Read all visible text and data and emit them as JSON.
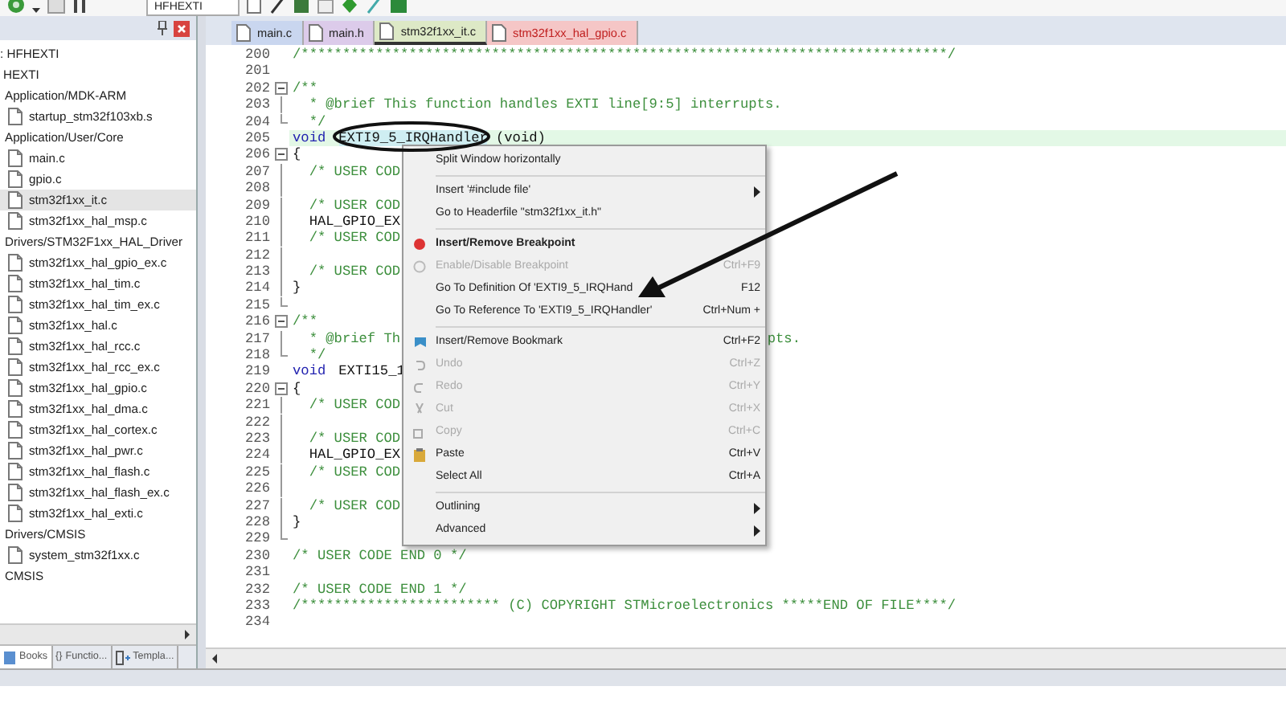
{
  "toolbar": {
    "target": "HFHEXTI"
  },
  "sidebar": {
    "tree": [
      {
        "label": ": HFHEXTI",
        "children": [
          {
            "label": "HEXTI",
            "children": [
              {
                "label": "Application/MDK-ARM",
                "children": [
                  {
                    "label": "startup_stm32f103xb.s",
                    "selected": false
                  }
                ]
              },
              {
                "label": "Application/User/Core",
                "children": [
                  {
                    "label": "main.c",
                    "selected": false
                  },
                  {
                    "label": "gpio.c",
                    "selected": false
                  },
                  {
                    "label": "stm32f1xx_it.c",
                    "selected": true
                  },
                  {
                    "label": "stm32f1xx_hal_msp.c",
                    "selected": false
                  }
                ]
              },
              {
                "label": "Drivers/STM32F1xx_HAL_Driver",
                "children": [
                  {
                    "label": "stm32f1xx_hal_gpio_ex.c",
                    "selected": false
                  },
                  {
                    "label": "stm32f1xx_hal_tim.c",
                    "selected": false
                  },
                  {
                    "label": "stm32f1xx_hal_tim_ex.c",
                    "selected": false
                  },
                  {
                    "label": "stm32f1xx_hal.c",
                    "selected": false
                  },
                  {
                    "label": "stm32f1xx_hal_rcc.c",
                    "selected": false
                  },
                  {
                    "label": "stm32f1xx_hal_rcc_ex.c",
                    "selected": false
                  },
                  {
                    "label": "stm32f1xx_hal_gpio.c",
                    "selected": false
                  },
                  {
                    "label": "stm32f1xx_hal_dma.c",
                    "selected": false
                  },
                  {
                    "label": "stm32f1xx_hal_cortex.c",
                    "selected": false
                  },
                  {
                    "label": "stm32f1xx_hal_pwr.c",
                    "selected": false
                  },
                  {
                    "label": "stm32f1xx_hal_flash.c",
                    "selected": false
                  },
                  {
                    "label": "stm32f1xx_hal_flash_ex.c",
                    "selected": false
                  },
                  {
                    "label": "stm32f1xx_hal_exti.c",
                    "selected": false
                  }
                ]
              },
              {
                "label": "Drivers/CMSIS",
                "children": [
                  {
                    "label": "system_stm32f1xx.c",
                    "selected": false
                  }
                ]
              },
              {
                "label": "CMSIS"
              }
            ]
          }
        ]
      }
    ],
    "bottom_tabs": [
      {
        "label": "Books",
        "selected": true
      },
      {
        "glyph": "{}",
        "label": "Functio...",
        "selected": false
      },
      {
        "label": "Templa...",
        "selected": false
      }
    ]
  },
  "editor": {
    "tabs": [
      {
        "label": "main.c",
        "color": "#c9d6ef",
        "selected": false
      },
      {
        "label": "main.h",
        "color": "#dccbea",
        "selected": false
      },
      {
        "label": "stm32f1xx_it.c",
        "color": "#dde9c6",
        "selected": true
      },
      {
        "label": "stm32f1xx_hal_gpio.c",
        "color": "#f5c6c6",
        "selected": false
      }
    ],
    "lines": [
      {
        "number": "200",
        "kind": "plain",
        "parts": [
          {
            "kind": "comment",
            "text": "/******************************************************************************/"
          }
        ]
      },
      {
        "number": "201",
        "kind": "plain"
      },
      {
        "number": "202",
        "kind": "foldstart",
        "parts": [
          {
            "kind": "comment",
            "text": "/**"
          }
        ]
      },
      {
        "number": "203",
        "kind": "foldbody",
        "parts": [
          {
            "kind": "comment",
            "text": "  * @brief This function handles EXTI line[9:5] interrupts."
          }
        ]
      },
      {
        "number": "204",
        "kind": "foldend",
        "parts": [
          {
            "kind": "comment",
            "text": "  */"
          }
        ]
      },
      {
        "number": "205",
        "kind": "plain",
        "current": true,
        "parts": [
          {
            "kind": "keyword",
            "text": "void"
          },
          {
            "kind": "selected",
            "text": "EXTI9_5_IRQHandler"
          },
          {
            "kind": "plain",
            "text": "(void)"
          }
        ]
      },
      {
        "number": "206",
        "kind": "foldstart",
        "parts": [
          {
            "kind": "plain",
            "text": "{"
          }
        ]
      },
      {
        "number": "207",
        "kind": "foldbody",
        "parts": [
          {
            "kind": "comment",
            "text": "  /* USER COD"
          }
        ]
      },
      {
        "number": "208",
        "kind": "foldbody"
      },
      {
        "number": "209",
        "kind": "foldbody",
        "parts": [
          {
            "kind": "comment",
            "text": "  /* USER COD"
          }
        ]
      },
      {
        "number": "210",
        "kind": "foldbody",
        "parts": [
          {
            "kind": "plain",
            "text": "  HAL_GPIO_EX"
          }
        ]
      },
      {
        "number": "211",
        "kind": "foldbody",
        "parts": [
          {
            "kind": "comment",
            "text": "  /* USER COD"
          }
        ]
      },
      {
        "number": "212",
        "kind": "foldbody"
      },
      {
        "number": "213",
        "kind": "foldbody",
        "parts": [
          {
            "kind": "comment",
            "text": "  /* USER COD"
          }
        ]
      },
      {
        "number": "214",
        "kind": "foldbody",
        "parts": [
          {
            "kind": "plain",
            "text": "}"
          }
        ]
      },
      {
        "number": "215",
        "kind": "foldend"
      },
      {
        "number": "216",
        "kind": "foldstart",
        "parts": [
          {
            "kind": "comment",
            "text": "/**"
          }
        ]
      },
      {
        "number": "217",
        "kind": "foldbody",
        "parts": [
          {
            "kind": "comment",
            "text": "  * @brief Th"
          }
        ],
        "tail": "pts."
      },
      {
        "number": "218",
        "kind": "foldend",
        "parts": [
          {
            "kind": "comment",
            "text": "  */"
          }
        ]
      },
      {
        "number": "219",
        "kind": "plain",
        "parts": [
          {
            "kind": "keyword",
            "text": "void"
          },
          {
            "kind": "plain",
            "text": "EXTI15_1"
          }
        ]
      },
      {
        "number": "220",
        "kind": "foldstart",
        "parts": [
          {
            "kind": "plain",
            "text": "{"
          }
        ]
      },
      {
        "number": "221",
        "kind": "foldbody",
        "parts": [
          {
            "kind": "comment",
            "text": "  /* USER COD"
          }
        ]
      },
      {
        "number": "222",
        "kind": "foldbody"
      },
      {
        "number": "223",
        "kind": "foldbody",
        "parts": [
          {
            "kind": "comment",
            "text": "  /* USER COD"
          }
        ]
      },
      {
        "number": "224",
        "kind": "foldbody",
        "parts": [
          {
            "kind": "plain",
            "text": "  HAL_GPIO_EX"
          }
        ]
      },
      {
        "number": "225",
        "kind": "foldbody",
        "parts": [
          {
            "kind": "comment",
            "text": "  /* USER COD"
          }
        ]
      },
      {
        "number": "226",
        "kind": "foldbody"
      },
      {
        "number": "227",
        "kind": "foldbody",
        "parts": [
          {
            "kind": "comment",
            "text": "  /* USER COD"
          }
        ]
      },
      {
        "number": "228",
        "kind": "foldbody",
        "parts": [
          {
            "kind": "plain",
            "text": "}"
          }
        ]
      },
      {
        "number": "229",
        "kind": "foldend"
      },
      {
        "number": "230",
        "kind": "plain",
        "parts": [
          {
            "kind": "comment",
            "text": "/* USER CODE END 0 */"
          }
        ]
      },
      {
        "number": "231",
        "kind": "plain"
      },
      {
        "number": "232",
        "kind": "plain",
        "parts": [
          {
            "kind": "comment",
            "text": "/* USER CODE END 1 */"
          }
        ]
      },
      {
        "number": "233",
        "kind": "plain",
        "parts": [
          {
            "kind": "comment",
            "text": "/************************ (C) COPYRIGHT STMicroelectronics *****END OF FILE****/"
          }
        ]
      },
      {
        "number": "234",
        "kind": "plain"
      }
    ]
  },
  "context_menu": {
    "groups": [
      [
        {
          "label": "Split Window horizontally",
          "disabled": false
        }
      ],
      [
        {
          "label": "Insert '#include file'",
          "disabled": false,
          "submenu": true
        },
        {
          "label": "Go to Headerfile \"stm32f1xx_it.h\"",
          "disabled": false
        }
      ],
      [
        {
          "label": "Insert/Remove Breakpoint",
          "disabled": false,
          "bold": true
        },
        {
          "label": "Enable/Disable Breakpoint",
          "shortcut": "Ctrl+F9",
          "disabled": true
        },
        {
          "label": "Go To Definition Of 'EXTI9_5_IRQHand",
          "shortcut": "F12",
          "disabled": false
        },
        {
          "label": "Go To Reference To 'EXTI9_5_IRQHandler'",
          "shortcut": "Ctrl+Num +",
          "disabled": false
        }
      ],
      [
        {
          "label": "Insert/Remove Bookmark",
          "shortcut": "Ctrl+F2",
          "disabled": false
        },
        {
          "label": "Undo",
          "shortcut": "Ctrl+Z",
          "disabled": true
        },
        {
          "label": "Redo",
          "shortcut": "Ctrl+Y",
          "disabled": true
        },
        {
          "label": "Cut",
          "shortcut": "Ctrl+X",
          "disabled": true
        },
        {
          "label": "Copy",
          "shortcut": "Ctrl+C",
          "disabled": true
        },
        {
          "label": "Paste",
          "shortcut": "Ctrl+V",
          "disabled": false
        },
        {
          "label": "Select All",
          "shortcut": "Ctrl+A",
          "disabled": false
        }
      ],
      [
        {
          "label": "Outlining",
          "disabled": false,
          "submenu": true
        },
        {
          "label": "Advanced",
          "disabled": false,
          "submenu": true
        }
      ]
    ]
  }
}
